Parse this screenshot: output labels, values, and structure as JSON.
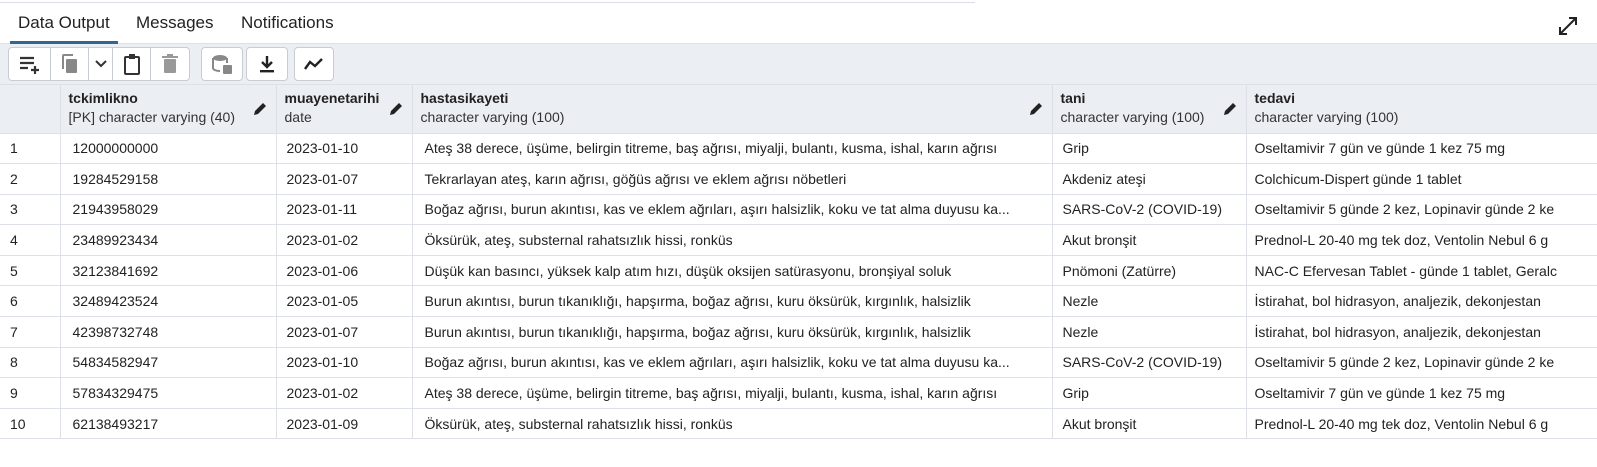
{
  "tabs": [
    {
      "label": "Data Output",
      "active": true
    },
    {
      "label": "Messages",
      "active": false
    },
    {
      "label": "Notifications",
      "active": false
    }
  ],
  "toolbar": {
    "icons": [
      "add-row-icon",
      "copy-icon",
      "dropdown-chevron-icon",
      "paste-icon",
      "delete-icon",
      "save-data-icon",
      "download-icon",
      "graph-visualiser-icon"
    ]
  },
  "columns": [
    {
      "name": "tckimlikno",
      "type": "[PK] character varying (40)"
    },
    {
      "name": "muayenetarihi",
      "type": "date"
    },
    {
      "name": "hastasikayeti",
      "type": "character varying (100)"
    },
    {
      "name": "tani",
      "type": "character varying (100)"
    },
    {
      "name": "tedavi",
      "type": "character varying (100)"
    }
  ],
  "rows": [
    {
      "num": "1",
      "tckimlikno": "12000000000",
      "muayenetarihi": "2023-01-10",
      "hastasikayeti": "Ateş 38 derece, üşüme, belirgin titreme, baş ağrısı, miyalji, bulantı, kusma, ishal, karın ağrısı",
      "tani": "Grip",
      "tedavi": "Oseltamivir 7 gün ve günde 1 kez 75 mg"
    },
    {
      "num": "2",
      "tckimlikno": "19284529158",
      "muayenetarihi": "2023-01-07",
      "hastasikayeti": "Tekrarlayan ateş, karın ağrısı, göğüs ağrısı ve eklem ağrısı nöbetleri",
      "tani": "Akdeniz ateşi",
      "tedavi": "Colchicum-Dispert günde 1 tablet"
    },
    {
      "num": "3",
      "tckimlikno": "21943958029",
      "muayenetarihi": "2023-01-11",
      "hastasikayeti": "Boğaz ağrısı, burun akıntısı, kas ve eklem ağrıları, aşırı halsizlik, koku ve tat alma duyusu ka...",
      "tani": "SARS-CoV-2 (COVID-19)",
      "tedavi": "Oseltamivir 5 günde 2 kez, Lopinavir günde 2 ke"
    },
    {
      "num": "4",
      "tckimlikno": "23489923434",
      "muayenetarihi": "2023-01-02",
      "hastasikayeti": "Öksürük, ateş, substernal rahatsızlık hissi, ronküs",
      "tani": "Akut bronşit",
      "tedavi": "Prednol-L 20-40 mg tek doz, Ventolin Nebul 6 g"
    },
    {
      "num": "5",
      "tckimlikno": "32123841692",
      "muayenetarihi": "2023-01-06",
      "hastasikayeti": "Düşük kan basıncı, yüksek kalp atım hızı, düşük oksijen satürasyonu, bronşiyal soluk",
      "tani": "Pnömoni (Zatürre)",
      "tedavi": "NAC-C Efervesan Tablet - günde 1 tablet, Geralc"
    },
    {
      "num": "6",
      "tckimlikno": "32489423524",
      "muayenetarihi": "2023-01-05",
      "hastasikayeti": "Burun akıntısı, burun tıkanıklığı, hapşırma, boğaz ağrısı, kuru öksürük, kırgınlık, halsizlik",
      "tani": "Nezle",
      "tedavi": "İstirahat, bol hidrasyon, analjezik, dekonjestan"
    },
    {
      "num": "7",
      "tckimlikno": "42398732748",
      "muayenetarihi": "2023-01-07",
      "hastasikayeti": "Burun akıntısı, burun tıkanıklığı, hapşırma, boğaz ağrısı, kuru öksürük, kırgınlık, halsizlik",
      "tani": "Nezle",
      "tedavi": "İstirahat, bol hidrasyon, analjezik, dekonjestan"
    },
    {
      "num": "8",
      "tckimlikno": "54834582947",
      "muayenetarihi": "2023-01-10",
      "hastasikayeti": "Boğaz ağrısı, burun akıntısı, kas ve eklem ağrıları, aşırı halsizlik, koku ve tat alma duyusu ka...",
      "tani": "SARS-CoV-2 (COVID-19)",
      "tedavi": "Oseltamivir 5 günde 2 kez, Lopinavir günde 2 ke"
    },
    {
      "num": "9",
      "tckimlikno": "57834329475",
      "muayenetarihi": "2023-01-02",
      "hastasikayeti": "Ateş 38 derece, üşüme, belirgin titreme, baş ağrısı, miyalji, bulantı, kusma, ishal, karın ağrısı",
      "tani": "Grip",
      "tedavi": "Oseltamivir 7 gün ve günde 1 kez 75 mg"
    },
    {
      "num": "10",
      "tckimlikno": "62138493217",
      "muayenetarihi": "2023-01-09",
      "hastasikayeti": "Öksürük, ateş, substernal rahatsızlık hissi, ronküs",
      "tani": "Akut bronşit",
      "tedavi": "Prednol-L 20-40 mg tek doz, Ventolin Nebul 6 g"
    }
  ]
}
